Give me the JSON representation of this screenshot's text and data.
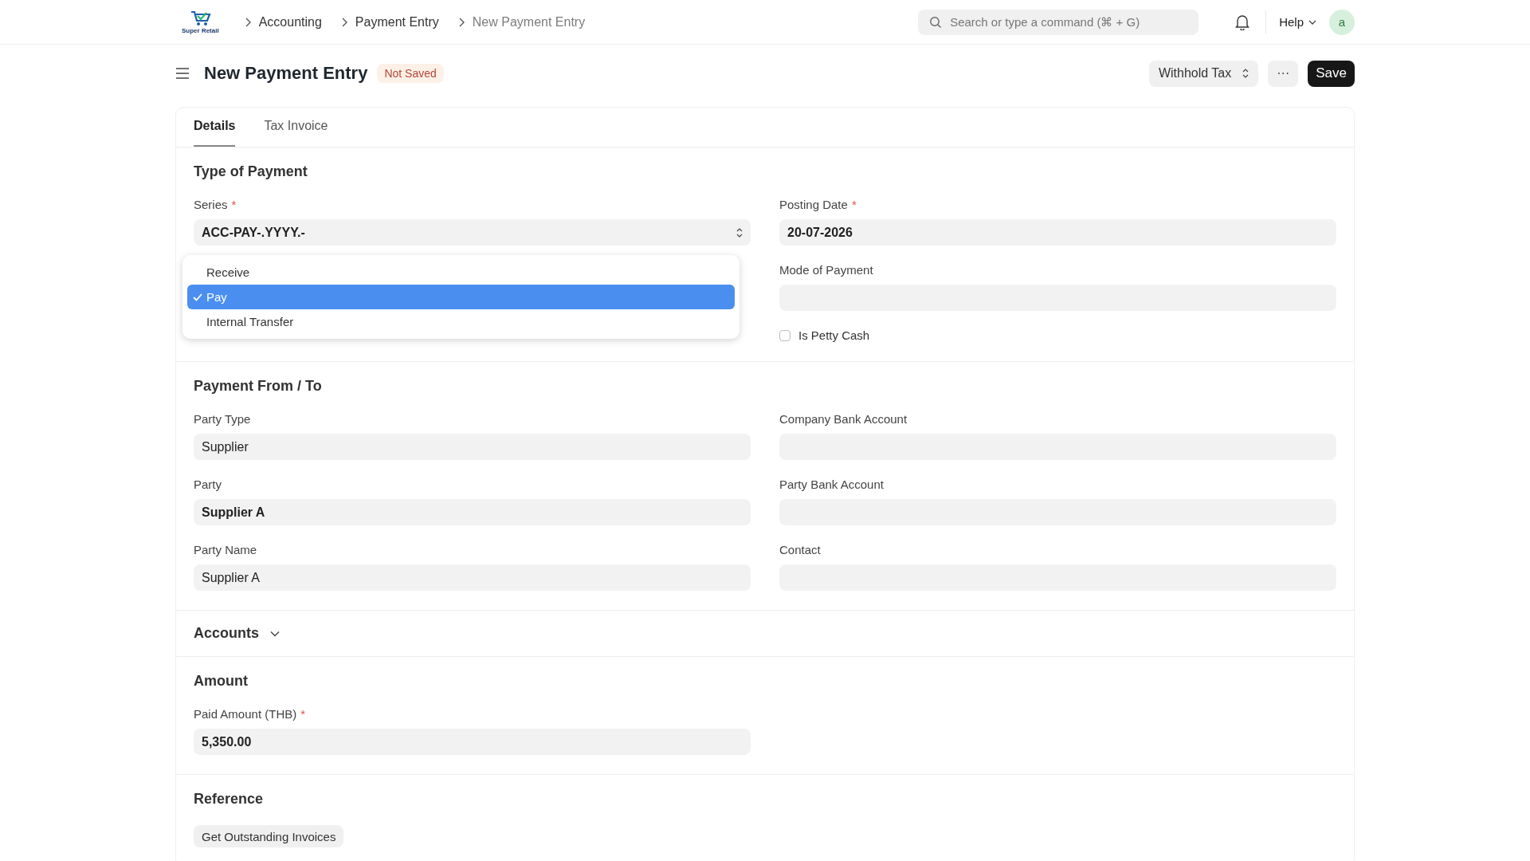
{
  "navbar": {
    "logo_text": "Super Retail",
    "breadcrumbs": [
      "Accounting",
      "Payment Entry",
      "New Payment Entry"
    ],
    "search": {
      "placeholder": "Search or type a command (⌘ + G)"
    },
    "help": "Help",
    "avatar": "a"
  },
  "page": {
    "title": "New Payment Entry",
    "status": "Not Saved",
    "actions": {
      "withhold": "Withhold Tax",
      "more": "···",
      "save": "Save"
    }
  },
  "tabs": [
    {
      "label": "Details",
      "selected": true
    },
    {
      "label": "Tax Invoice",
      "selected": false
    }
  ],
  "type_of_payment": {
    "heading": "Type of Payment",
    "series": {
      "label": "Series",
      "required_mark": "*",
      "value": "ACC-PAY-.YYYY.-"
    },
    "payment_type_menu": [
      {
        "label": "Receive",
        "selected": false
      },
      {
        "label": "Pay",
        "selected": true
      },
      {
        "label": "Internal Transfer",
        "selected": false
      }
    ],
    "posting_date": {
      "label": "Posting Date",
      "required_mark": "*",
      "value": "20-07-2026"
    },
    "mode_of_payment": {
      "label": "Mode of Payment"
    },
    "is_petty_cash": {
      "label": "Is Petty Cash",
      "checked": false
    }
  },
  "payment_from_to": {
    "heading": "Payment From / To",
    "left": [
      {
        "label": "Party Type",
        "kind": "select",
        "value": "Supplier"
      },
      {
        "label": "Party",
        "kind": "link",
        "value": "Supplier A"
      },
      {
        "label": "Party Name",
        "kind": "data",
        "value": "Supplier A"
      }
    ],
    "right": [
      {
        "label": "Company Bank Account"
      },
      {
        "label": "Party Bank Account"
      },
      {
        "label": "Contact"
      }
    ]
  },
  "accounts": {
    "heading": "Accounts",
    "expanded": false
  },
  "amount": {
    "heading": "Amount",
    "paid": {
      "label": "Paid Amount (THB)",
      "required_mark": "*",
      "value": "5,350.00"
    }
  },
  "reference": {
    "heading": "Reference",
    "button": "Get Outstanding Invoices"
  }
}
